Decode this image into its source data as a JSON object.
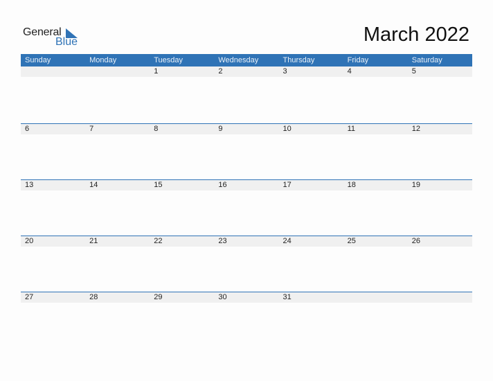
{
  "logo": {
    "line1": "General",
    "line2": "Blue"
  },
  "title": "March 2022",
  "accent_color": "#2f73b6",
  "weekdays": [
    "Sunday",
    "Monday",
    "Tuesday",
    "Wednesday",
    "Thursday",
    "Friday",
    "Saturday"
  ],
  "weeks": [
    [
      "",
      "",
      "1",
      "2",
      "3",
      "4",
      "5"
    ],
    [
      "6",
      "7",
      "8",
      "9",
      "10",
      "11",
      "12"
    ],
    [
      "13",
      "14",
      "15",
      "16",
      "17",
      "18",
      "19"
    ],
    [
      "20",
      "21",
      "22",
      "23",
      "24",
      "25",
      "26"
    ],
    [
      "27",
      "28",
      "29",
      "30",
      "31",
      "",
      ""
    ]
  ]
}
